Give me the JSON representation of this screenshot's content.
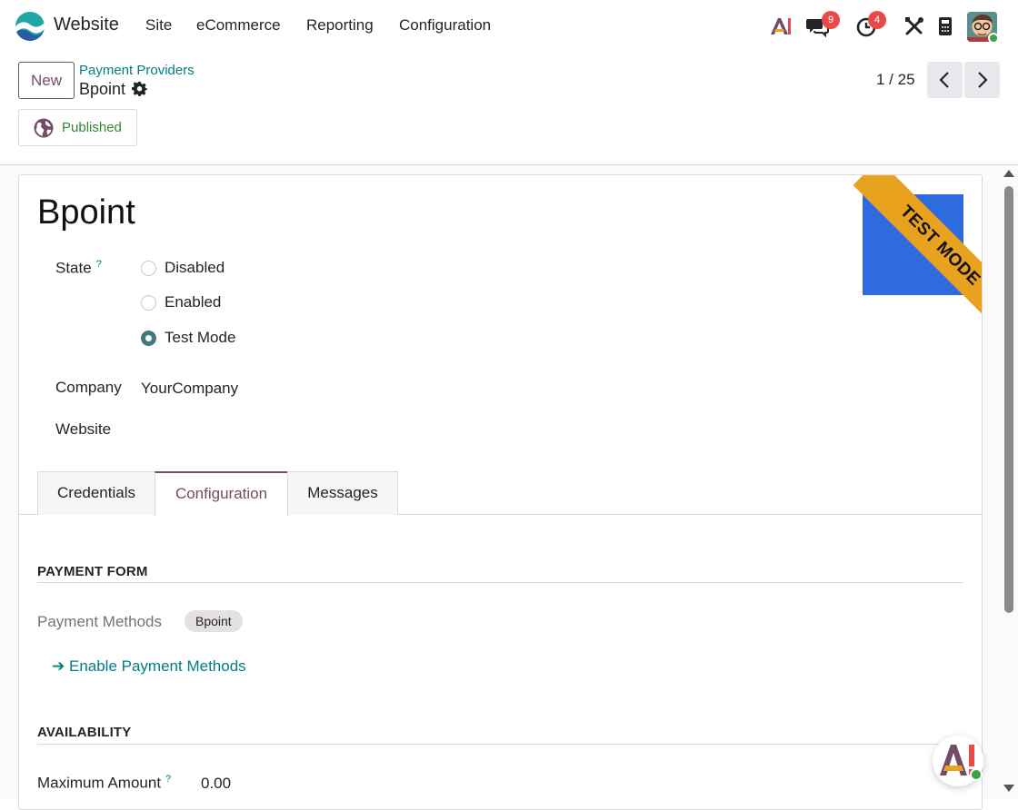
{
  "navbar": {
    "app_name": "Website",
    "menu": [
      "Site",
      "eCommerce",
      "Reporting",
      "Configuration"
    ],
    "icons": [
      "ai-icon",
      "chat-icon",
      "activity-clock-icon",
      "tools-icon",
      "phone-icon"
    ],
    "chat_count": "9",
    "activity_count": "4"
  },
  "control_panel": {
    "new_label": "New",
    "breadcrumb_parent": "Payment Providers",
    "record_name": "Bpoint",
    "pager": "1 / 25",
    "published_label": "Published"
  },
  "form": {
    "title": "Bpoint",
    "ribbon": "TEST MODE",
    "state_label": "State",
    "help_mark": "?",
    "state_options": [
      "Disabled",
      "Enabled",
      "Test Mode"
    ],
    "state_selected": "Test Mode",
    "company_label": "Company",
    "company_value": "YourCompany",
    "website_label": "Website",
    "website_value": ""
  },
  "tabs": [
    "Credentials",
    "Configuration",
    "Messages"
  ],
  "active_tab": "Configuration",
  "configuration": {
    "payment_form_title": "PAYMENT FORM",
    "payment_methods_label": "Payment Methods",
    "payment_methods": [
      "Bpoint"
    ],
    "enable_link": "Enable Payment Methods",
    "enable_arrow": "➔",
    "availability_title": "AVAILABILITY",
    "max_amount_label": "Maximum Amount",
    "max_amount_value": "0.00"
  },
  "colors": {
    "brand": "#714b67",
    "link": "#017e84",
    "ribbon": "#e9a21d",
    "radio_checked": "#3f7a7e",
    "badge": "#e84a4a",
    "published": "#2f8a30"
  }
}
